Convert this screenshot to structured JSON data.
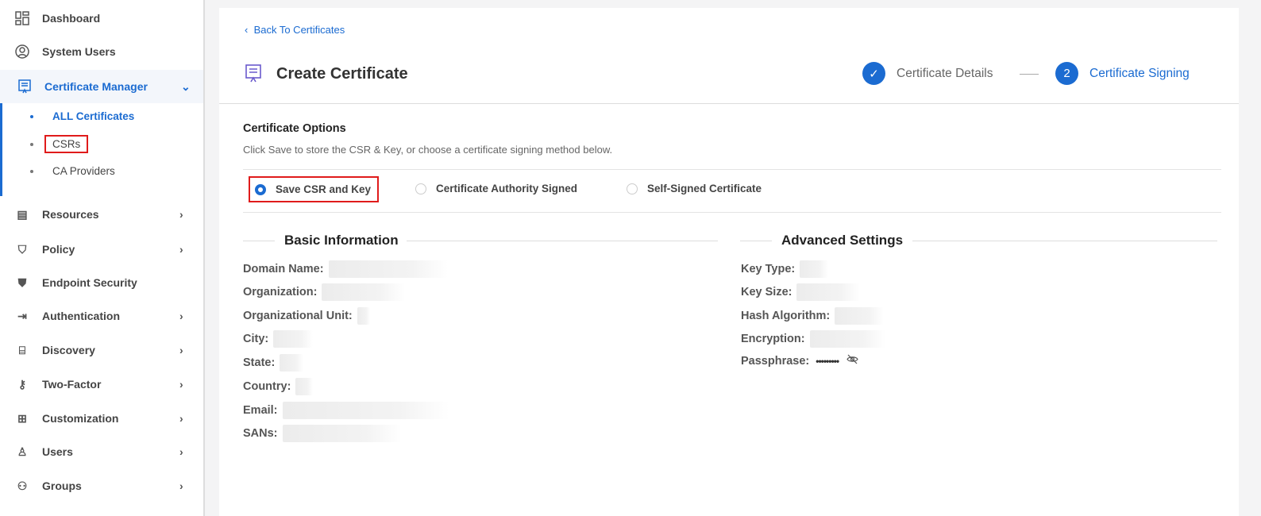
{
  "sidebar": {
    "items": [
      {
        "label": "Dashboard",
        "icon": "dashboard-icon"
      },
      {
        "label": "System Users",
        "icon": "user-circle-icon"
      },
      {
        "label": "Certificate Manager",
        "icon": "certificate-icon"
      },
      {
        "label": "Resources",
        "icon": "server-icon"
      },
      {
        "label": "Policy",
        "icon": "shield-icon"
      },
      {
        "label": "Endpoint Security",
        "icon": "shield-filled-icon"
      },
      {
        "label": "Authentication",
        "icon": "login-icon"
      },
      {
        "label": "Discovery",
        "icon": "router-icon"
      },
      {
        "label": "Two-Factor",
        "icon": "key-icon"
      },
      {
        "label": "Customization",
        "icon": "grid-plus-icon"
      },
      {
        "label": "Users",
        "icon": "user-icon"
      },
      {
        "label": "Groups",
        "icon": "users-icon"
      }
    ],
    "sub": [
      "ALL Certificates",
      "CSRs",
      "CA Providers"
    ]
  },
  "page": {
    "back": "Back To Certificates",
    "title": "Create Certificate",
    "steps": [
      {
        "num": "✓",
        "label": "Certificate Details"
      },
      {
        "num": "2",
        "label": "Certificate Signing"
      }
    ],
    "options_title": "Certificate Options",
    "options_desc": "Click Save to store the CSR & Key, or choose a certificate signing method below.",
    "options": [
      "Save CSR and Key",
      "Certificate Authority Signed",
      "Self-Signed Certificate"
    ],
    "selected_option": "Save CSR and Key",
    "basic_title": "Basic Information",
    "basic": [
      "Domain Name:",
      "Organization:",
      "Organizational Unit:",
      "City:",
      "State:",
      "Country:",
      "Email:",
      "SANs:"
    ],
    "advanced_title": "Advanced Settings",
    "advanced": [
      "Key Type:",
      "Key Size:",
      "Hash Algorithm:",
      "Encryption:",
      "Passphrase:"
    ],
    "passphrase": "•••••••••"
  },
  "colors": {
    "accent": "#1b6bd1",
    "highlight": "#e01b1b"
  }
}
